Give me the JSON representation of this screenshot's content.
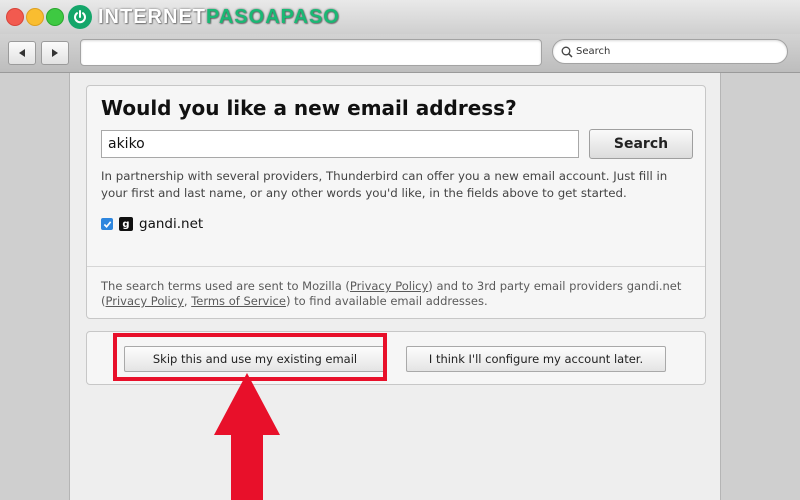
{
  "window": {
    "brand_prefix": "INTERNET",
    "brand_accent": "PASOAPASO",
    "colors": {
      "close": "#f25a4f",
      "minimize": "#f9bd30",
      "maximize": "#3ec942",
      "brand_green": "#15a66a",
      "highlight": "#e8102a"
    }
  },
  "toolbar": {
    "url_value": "",
    "search_placeholder": "Search"
  },
  "dialog": {
    "heading": "Would you like a new email address?",
    "name_input_value": "akiko",
    "search_button": "Search",
    "description": "In partnership with several providers, Thunderbird can offer you a new email account. Just fill in your first and last name, or any other words you'd like, in the fields above to get started.",
    "providers": [
      {
        "name": "gandi.net",
        "checked": true,
        "icon": "gandi-icon"
      }
    ],
    "privacy": {
      "part1": "The search terms used are sent to Mozilla (",
      "link1": "Privacy Policy",
      "part2": ") and to 3rd party email providers gandi.net (",
      "link2": "Privacy Policy",
      "part3": ", ",
      "link3": "Terms of Service",
      "part4": ") to find available email addresses."
    },
    "skip_button": "Skip this and use my existing email",
    "later_button": "I think I'll configure my account later."
  }
}
